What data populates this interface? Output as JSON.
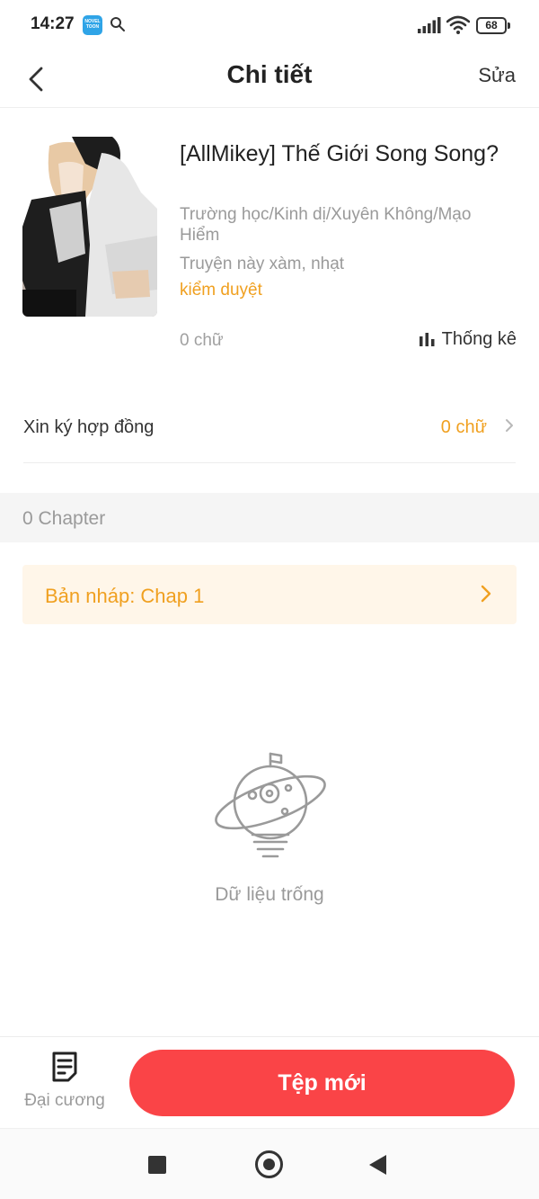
{
  "status_bar": {
    "time": "14:27",
    "app_badge": "NOVEL TOON",
    "battery": "68"
  },
  "header": {
    "title": "Chi tiết",
    "edit_label": "Sửa"
  },
  "book": {
    "title": "[AllMikey] Thế Giới Song Song?",
    "genres": "Trường học/Kinh dị/Xuyên Không/Mạo Hiểm",
    "note": "Truyện này xàm, nhạt",
    "status": "kiểm duyệt",
    "word_count": "0 chữ",
    "stats_label": "Thống kê"
  },
  "contract": {
    "label": "Xin ký hợp đồng",
    "value": "0 chữ"
  },
  "chapters": {
    "count_label": "0 Chapter"
  },
  "draft": {
    "label": "Bản nháp: Chap 1"
  },
  "empty_state": {
    "text": "Dữ liệu trống"
  },
  "bottom_bar": {
    "outline_label": "Đại cương",
    "new_file_label": "Tệp mới"
  },
  "colors": {
    "accent_orange": "#f0a020",
    "primary_red": "#fa4447",
    "draft_background": "#fff6e9"
  }
}
